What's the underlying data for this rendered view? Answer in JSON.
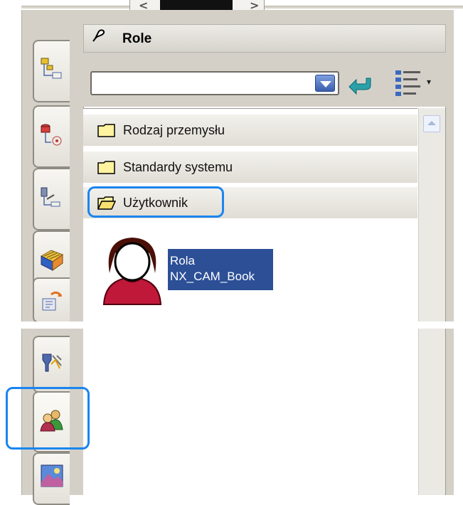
{
  "panel": {
    "title": "Role",
    "combo_value": "",
    "icons": {
      "pin": "pin-icon",
      "dropdown": "dropdown-arrow-icon",
      "back": "back-arrow-icon",
      "view_mode": "list-view-icon"
    }
  },
  "tree": {
    "folders": [
      {
        "label": "Rodzaj przemysłu",
        "icon": "folder-icon"
      },
      {
        "label": "Standardy systemu",
        "icon": "folder-icon"
      },
      {
        "label": "Użytkownik",
        "icon": "open-folder-icon"
      }
    ],
    "role_item": {
      "line1": "Rola",
      "line2": "NX_CAM_Book",
      "icon": "user-role-icon"
    }
  },
  "left_tabs": [
    {
      "icon": "assembly-navigator-icon"
    },
    {
      "icon": "constraint-navigator-icon"
    },
    {
      "icon": "part-navigator-icon"
    },
    {
      "icon": "reuse-library-icon"
    },
    {
      "icon": "hd3d-tools-icon"
    },
    {
      "icon": "web-browser-icon"
    },
    {
      "icon": "roles-icon"
    },
    {
      "icon": "system-scenes-icon"
    }
  ],
  "colors": {
    "accent_highlight": "#1a85f0",
    "selection": "#2c4f96",
    "panel_bg": "#d4d0c8"
  }
}
